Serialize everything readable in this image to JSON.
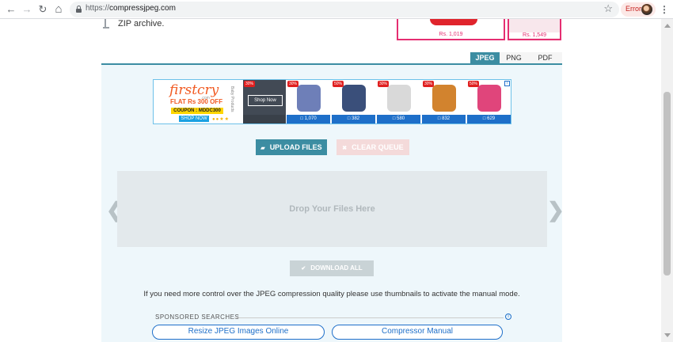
{
  "browser": {
    "url_proto": "https://",
    "url_host": "compressjpeg.com",
    "error_label": "Error",
    "back_glyph": "←",
    "forward_glyph": "→",
    "reload_glyph": "↻",
    "home_glyph": "⌂",
    "star_glyph": "☆",
    "menu_glyph": "⋮"
  },
  "header": {
    "zip_text": "ZIP archive."
  },
  "products": [
    {
      "price": "Rs. 1,019"
    },
    {
      "price": "Rs. 1,549"
    }
  ],
  "format_tabs": [
    {
      "label": "JPEG",
      "active": true
    },
    {
      "label": "PNG",
      "active": false
    },
    {
      "label": "PDF",
      "active": false
    }
  ],
  "ad": {
    "brand": "firstcry",
    "brand_sub": ".com",
    "side_text": "Baby Products",
    "offer": "FLAT Rs 300 OFF",
    "coupon": "COUPON : MDDC300",
    "shop_now_small": "SHOP NOW",
    "dots": "●●★★",
    "dark_badge": "30%",
    "dark_button": "Shop Now",
    "info_glyph": "i",
    "cards": [
      {
        "badge": "30%",
        "price": "□ 1,070",
        "color": "#6e7fb8"
      },
      {
        "badge": "50%",
        "price": "□ 382",
        "color": "#3a4f7a"
      },
      {
        "badge": "30%",
        "price": "□ 580",
        "color": "#d9d9d9"
      },
      {
        "badge": "30%",
        "price": "□ 832",
        "color": "#d2832e"
      },
      {
        "badge": "50%",
        "price": "□ 629",
        "color": "#e0457b"
      }
    ]
  },
  "actions": {
    "upload": "UPLOAD FILES",
    "upload_icon": "▰",
    "clear": "CLEAR QUEUE",
    "clear_icon": "✖",
    "download": "DOWNLOAD ALL",
    "download_icon": "✔"
  },
  "dropzone": {
    "text": "Drop Your Files Here",
    "prev_glyph": "❮",
    "next_glyph": "❯"
  },
  "note": "If you need more control over the JPEG compression quality please use thumbnails to activate the manual mode.",
  "sponsored": {
    "label": "SPONSORED SEARCHES",
    "info_glyph": "i",
    "links": [
      "Resize JPEG Images Online",
      "Compressor Manual"
    ]
  },
  "colors": {
    "accent": "#3c8da2",
    "link": "#1e6fc9",
    "ad_pink": "#e52e71"
  }
}
